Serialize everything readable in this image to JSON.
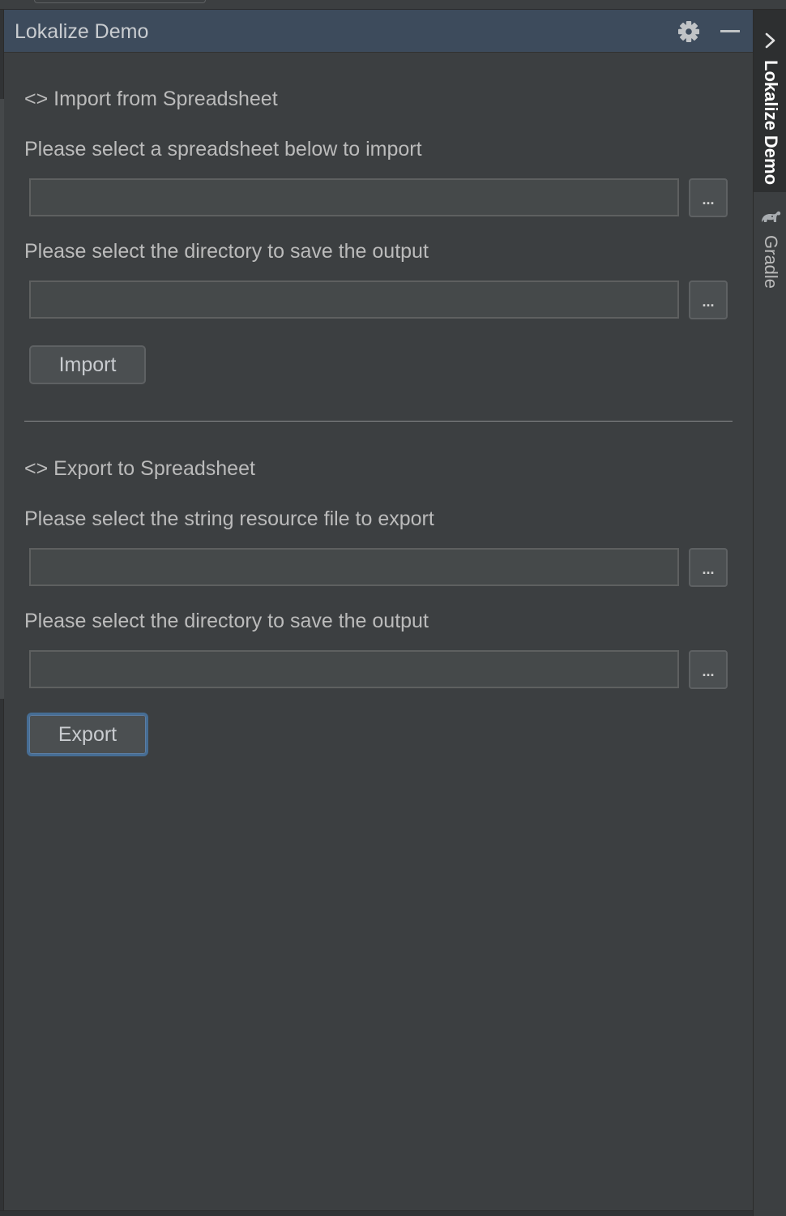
{
  "panel": {
    "title": "Lokalize Demo",
    "header_icons": [
      "gear-icon",
      "minimize-icon"
    ]
  },
  "import_section": {
    "title": "<> Import from Spreadsheet",
    "spreadsheet_label": "Please select a spreadsheet below to import",
    "spreadsheet_value": "",
    "output_dir_label": "Please select the directory to save the output",
    "output_dir_value": "",
    "browse_label": "...",
    "button_label": "Import"
  },
  "export_section": {
    "title": "<> Export to Spreadsheet",
    "resource_label": "Please select the string resource file to export",
    "resource_value": "",
    "output_dir_label": "Please select the directory to save the output",
    "output_dir_value": "",
    "browse_label": "...",
    "button_label": "Export"
  },
  "right_toolbar": {
    "tabs": [
      {
        "label": "Lokalize Demo",
        "active": true,
        "icon": "chevron-right-icon"
      },
      {
        "label": "Gradle",
        "active": false,
        "icon": "gradle-elephant-icon"
      }
    ]
  },
  "colors": {
    "background": "#3c3f41",
    "header": "#3d4b5c",
    "focus_border": "#466d94",
    "text": "#bbbbbb"
  }
}
